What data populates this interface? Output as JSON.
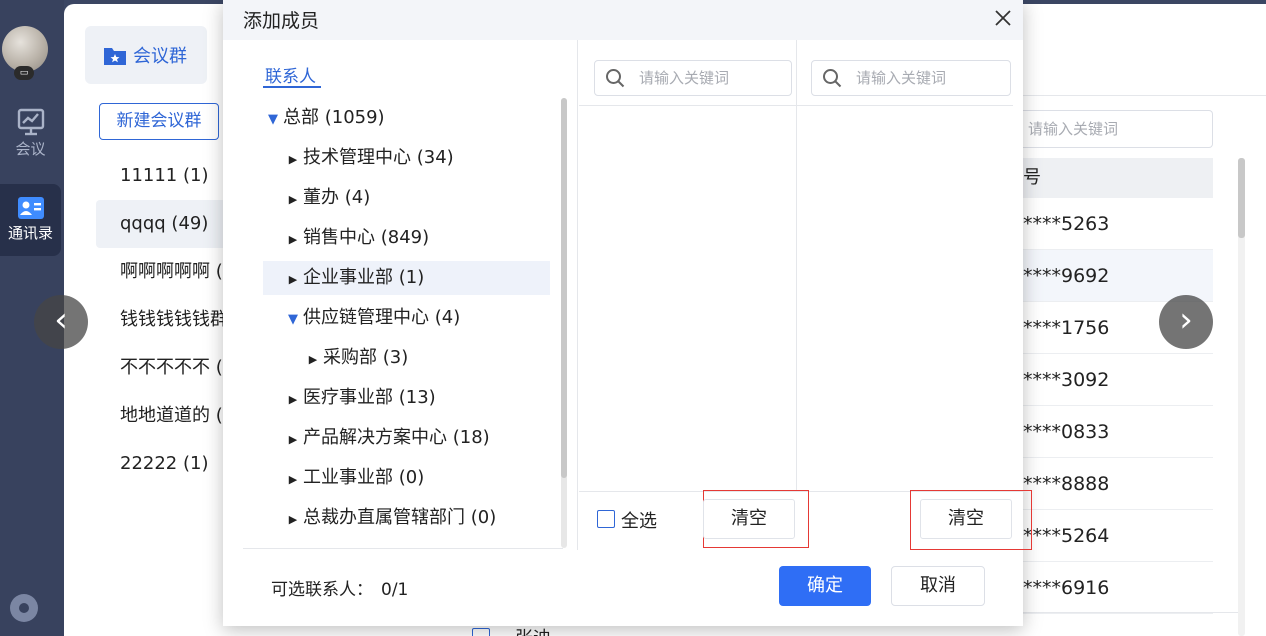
{
  "rail": {
    "meeting_label": "会议",
    "contacts_label": "通讯录"
  },
  "sidebar": {
    "meeting_group_tab": "会议群",
    "new_group_button": "新建会议群",
    "groups": [
      {
        "label": "11111 (1)"
      },
      {
        "label": "qqqq (49)"
      },
      {
        "label": "啊啊啊啊啊 ("
      },
      {
        "label": "钱钱钱钱钱群"
      },
      {
        "label": "不不不不不 ("
      },
      {
        "label": "地地道道的 ("
      },
      {
        "label": "22222 (1)"
      }
    ]
  },
  "contacts_table": {
    "search_placeholder": "请输入关键词",
    "column_header": "号",
    "rows": [
      {
        "phone": "****5263"
      },
      {
        "phone": "****9692"
      },
      {
        "phone": "****1756"
      },
      {
        "phone": "****3092"
      },
      {
        "phone": "****0833"
      },
      {
        "phone": "****8888"
      },
      {
        "phone": "****5264"
      },
      {
        "phone": "****6916"
      }
    ],
    "partial_name": "张迪"
  },
  "dialog": {
    "title": "添加成员",
    "tree_tab": "联系人",
    "tree": [
      {
        "label": "总部 (1059)",
        "expanded": true
      },
      {
        "label": "技术管理中心 (34)",
        "expanded": false
      },
      {
        "label": "董办 (4)",
        "expanded": false
      },
      {
        "label": "销售中心 (849)",
        "expanded": false
      },
      {
        "label": "企业事业部 (1)",
        "expanded": false
      },
      {
        "label": "供应链管理中心 (4)",
        "expanded": true
      },
      {
        "label": "采购部 (3)",
        "expanded": false
      },
      {
        "label": "医疗事业部 (13)",
        "expanded": false
      },
      {
        "label": "产品解决方案中心 (18)",
        "expanded": false
      },
      {
        "label": "工业事业部 (0)",
        "expanded": false
      },
      {
        "label": "总裁办直属管辖部门 (0)",
        "expanded": false
      }
    ],
    "search_left_placeholder": "请输入关键词",
    "search_right_placeholder": "请输入关键词",
    "select_all_label": "全选",
    "clear_left_label": "清空",
    "clear_right_label": "清空",
    "selectable_label": "可选联系人：",
    "selectable_count": "0/1",
    "ok_label": "确定",
    "cancel_label": "取消"
  },
  "colors": {
    "accent": "#2f66d6",
    "primary_button": "#2f6ef5",
    "highlight_frame": "#e53935",
    "rail_bg": "#38425e"
  }
}
